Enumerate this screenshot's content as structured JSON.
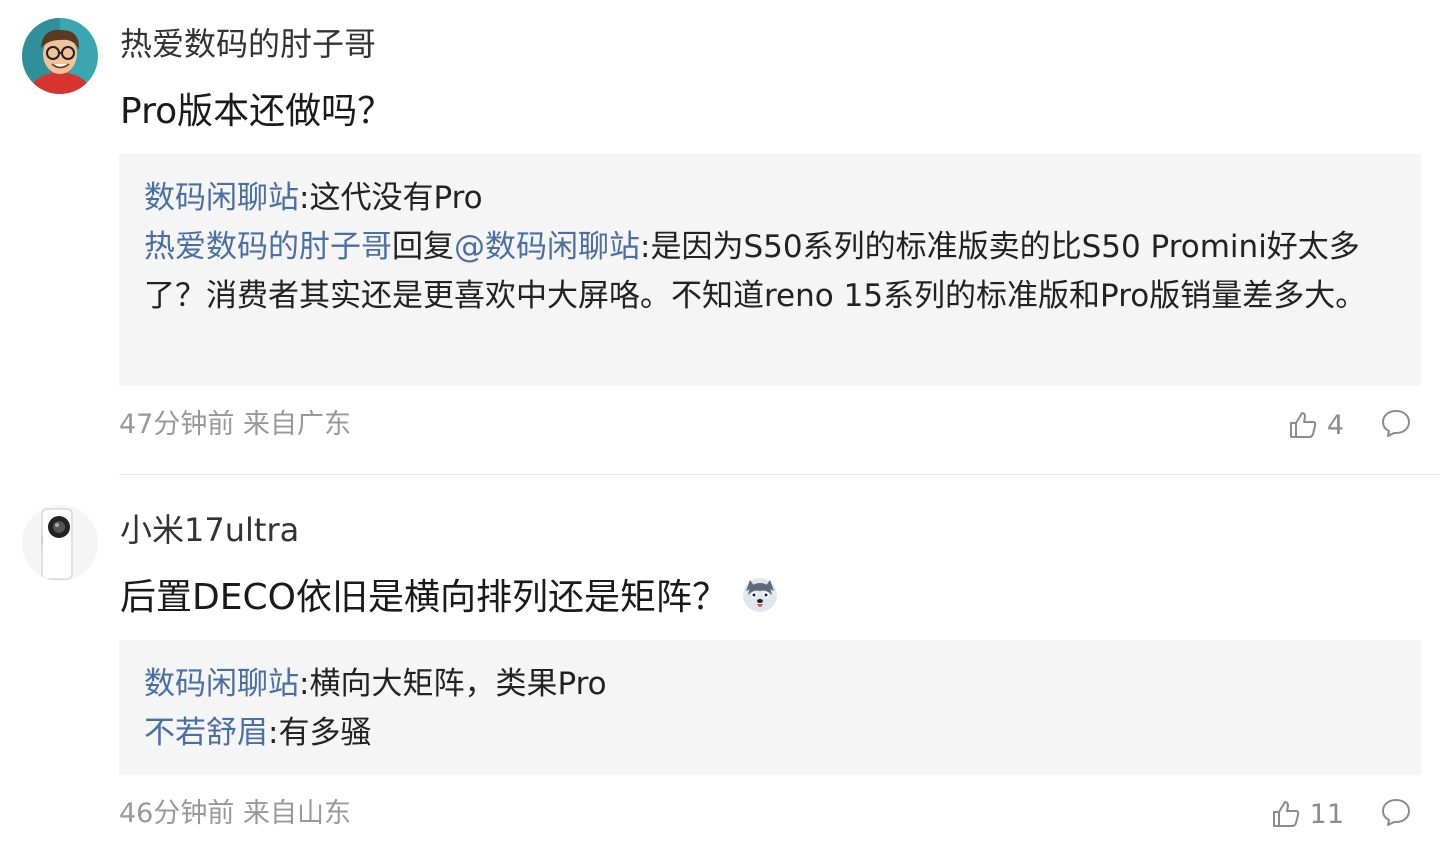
{
  "comments": [
    {
      "username": "热爱数码的肘子哥",
      "content": "Pro版本还做吗？",
      "replies": [
        {
          "author": "数码闲聊站",
          "separator": ":",
          "text": "这代没有Pro"
        },
        {
          "author": "热爱数码的肘子哥",
          "reply_word": "回复",
          "mention": "@数码闲聊站",
          "separator": ":",
          "text": "是因为S50系列的标准版卖的比S50 Promini好太多了？消费者其实还是更喜欢中大屏咯。不知道reno 15系列的标准版和Pro版销量差多大。"
        }
      ],
      "time": "47分钟前 来自广东",
      "likes": "4"
    },
    {
      "username": "小米17ultra",
      "content": "后置DECO依旧是横向排列还是矩阵？",
      "emoji_icon": "husky-face-icon",
      "replies": [
        {
          "author": "数码闲聊站",
          "separator": ":",
          "text": "横向大矩阵，类果Pro"
        },
        {
          "author": "不若舒眉",
          "separator": ":",
          "text": "有多骚"
        }
      ],
      "time": "46分钟前 来自山东",
      "likes": "11"
    }
  ],
  "colors": {
    "link": "#4a6fa5",
    "meta": "#999999",
    "reply_bg": "#f5f5f5"
  }
}
